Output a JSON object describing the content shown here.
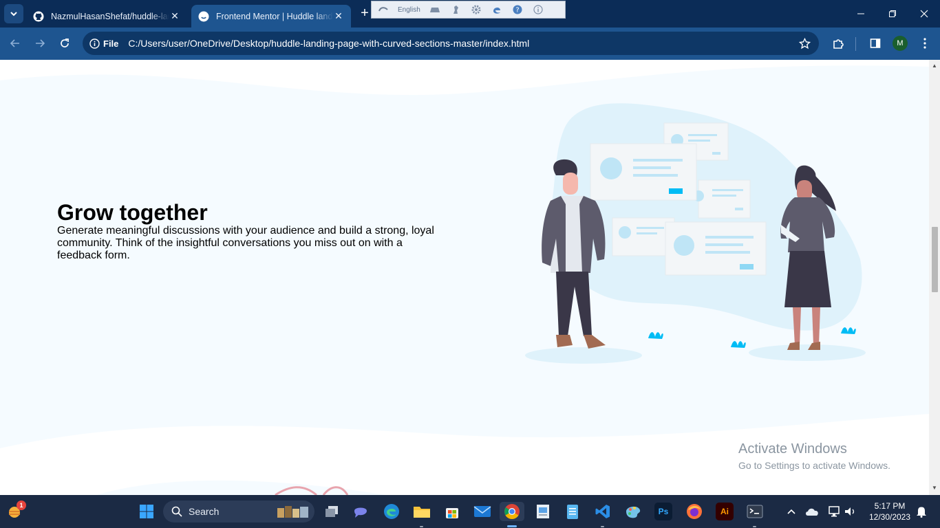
{
  "browser": {
    "tabs": [
      {
        "title": "NazmulHasanShefat/huddle-landing-page",
        "favicon": "github-icon"
      },
      {
        "title": "Frontend Mentor | Huddle landing page",
        "favicon": "frontend-mentor-icon"
      }
    ],
    "ime_label": "English",
    "address": {
      "chip": "File",
      "url": "C:/Users/user/OneDrive/Desktop/huddle-landing-page-with-curved-sections-master/index.html"
    },
    "profile_initial": "M"
  },
  "page": {
    "feature": {
      "title": "Grow together",
      "description": "Generate meaningful discussions with your audience and build a strong, loyal community. Think of the insightful conversations you miss out on with a feedback form."
    },
    "watermark": {
      "line1": "Activate Windows",
      "line2": "Go to Settings to activate Windows."
    }
  },
  "taskbar": {
    "search_label": "Search",
    "notification_count": "1",
    "clock_time": "5:17 PM",
    "clock_date": "12/30/2023",
    "apps": [
      "Start",
      "Task View",
      "Meet",
      "Edge",
      "File Explorer",
      "Microsoft Store",
      "Mail",
      "Chrome",
      "Photos",
      "Notepad",
      "VS Code",
      "Paint",
      "Photoshop",
      "Firefox",
      "Illustrator",
      "Terminal"
    ]
  },
  "colors": {
    "tabbar": "#0b2c57",
    "toolbar": "#1e5590",
    "section_bg": "#f5fbff",
    "accent_cyan": "#00bcf5"
  }
}
